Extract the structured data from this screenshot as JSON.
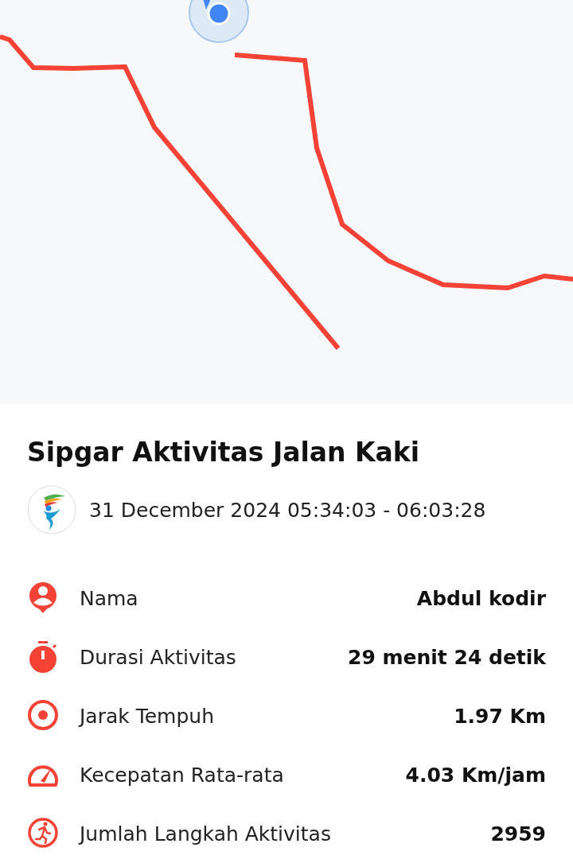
{
  "title": "Sipgar Aktivitas Jalan Kaki",
  "date_range": "31 December 2024 05:34:03 - 06:03:28",
  "details": [
    {
      "label": "Nama",
      "value": "Abdul kodir"
    },
    {
      "label": "Durasi Aktivitas",
      "value": "29 menit 24 detik"
    },
    {
      "label": "Jarak Tempuh",
      "value": "1.97 Km"
    },
    {
      "label": "Kecepatan Rata-rata",
      "value": "4.03 Km/jam"
    },
    {
      "label": "Jumlah Langkah Aktivitas",
      "value": "2959"
    }
  ]
}
